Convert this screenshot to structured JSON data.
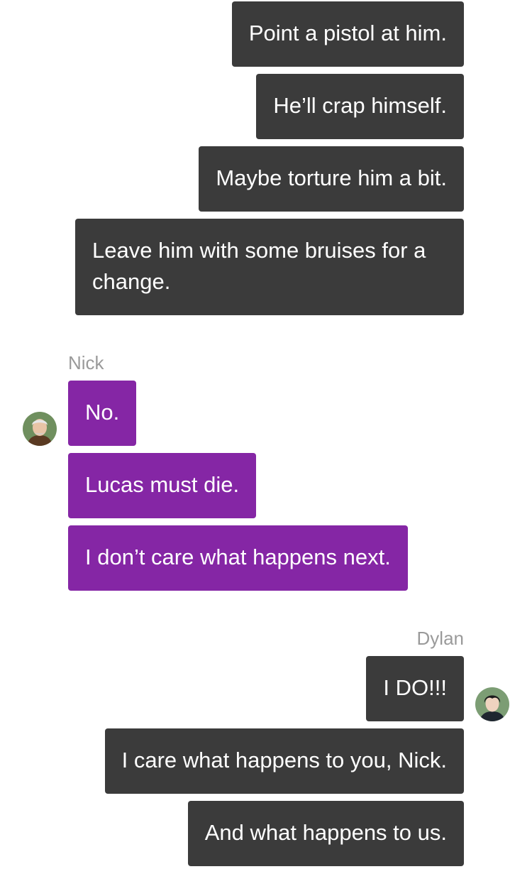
{
  "messages_top": [
    "Point a pistol at him.",
    "He’ll crap himself.",
    "Maybe torture him a bit.",
    "Leave him with some bruises for a change."
  ],
  "nick": {
    "name": "Nick",
    "color": "#8526a5",
    "messages": [
      "No.",
      "Lucas must die.",
      "I don’t care what happens next."
    ]
  },
  "dylan": {
    "name": "Dylan",
    "color": "#3b3b3b",
    "messages": [
      "I DO!!!",
      "I care what happens to you, Nick.",
      "And what happens to us."
    ]
  }
}
